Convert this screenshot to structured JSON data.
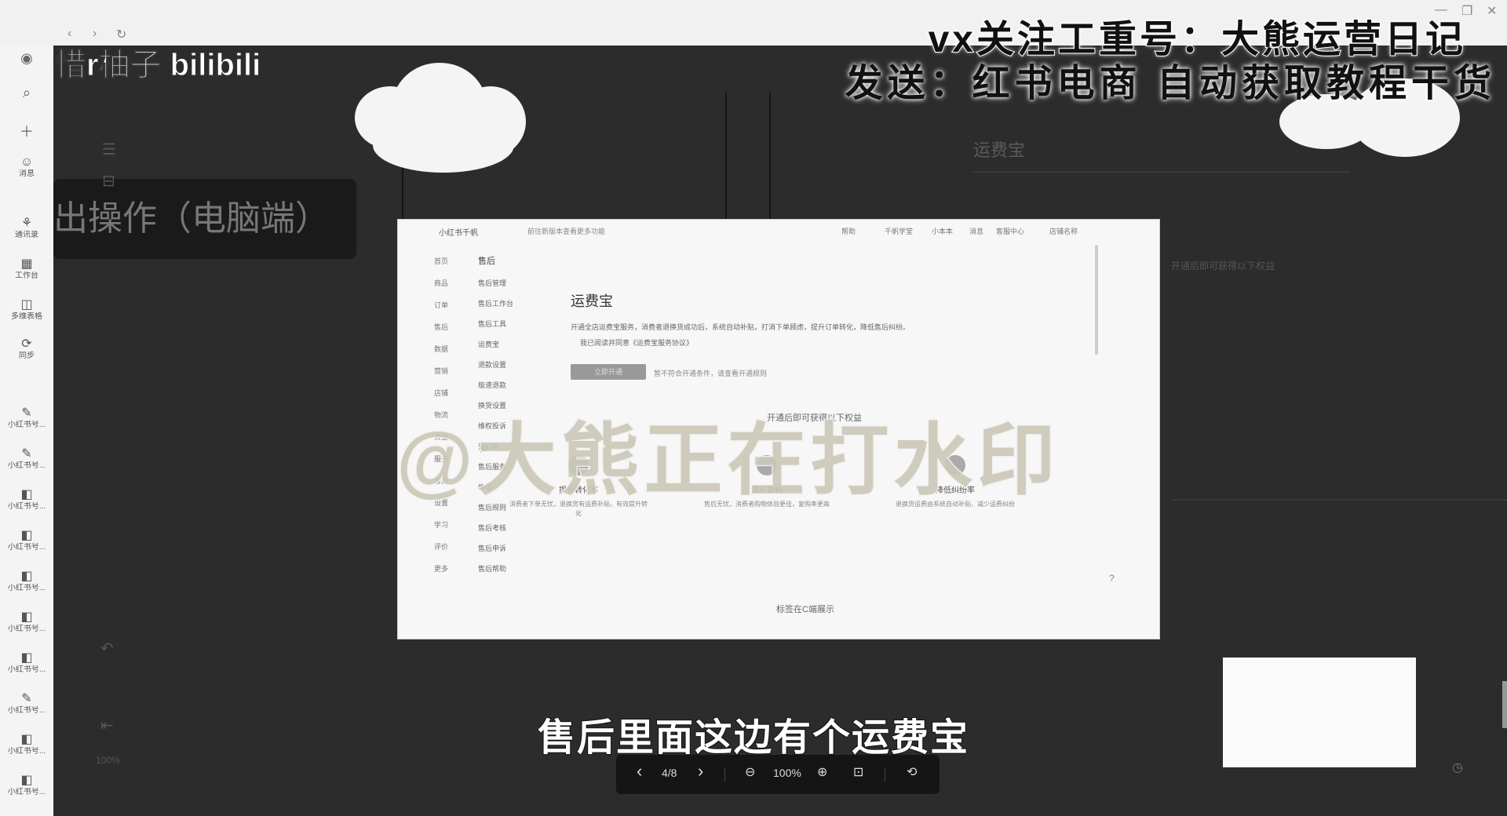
{
  "topbar": {
    "nav": [
      "‹",
      "›",
      "↻"
    ],
    "window_controls": [
      "—",
      "❐",
      "✕"
    ]
  },
  "brand": {
    "text": "惜r柚子 bilibili"
  },
  "watermarks": {
    "vx": "vx关注工重号：大熊运营日记",
    "send": "发送：红书电商  自动获取教程干货",
    "center": "@大熊正在打水印"
  },
  "rail": {
    "items": [
      {
        "icon": "☺",
        "label": "消息"
      },
      {
        "icon": "⚘",
        "label": "通讯录"
      },
      {
        "icon": "▦",
        "label": "工作台"
      },
      {
        "icon": "◫",
        "label": "多维表格"
      },
      {
        "icon": "⟳",
        "label": "同步"
      },
      {
        "icon": "✎",
        "label": "小红书号..."
      },
      {
        "icon": "✎",
        "label": "小红书号..."
      },
      {
        "icon": "◧",
        "label": "小红书号..."
      },
      {
        "icon": "◧",
        "label": "小红书号..."
      },
      {
        "icon": "◧",
        "label": "小红书号..."
      },
      {
        "icon": "◧",
        "label": "小红书号..."
      },
      {
        "icon": "◧",
        "label": "小红书号..."
      },
      {
        "icon": "✎",
        "label": "小红书号..."
      },
      {
        "icon": "◧",
        "label": "小红书号..."
      },
      {
        "icon": "◧",
        "label": "小红书号..."
      }
    ]
  },
  "canvas": {
    "node_text": "出操作（电脑端）",
    "ghost_title": "运费宝",
    "ghost_section": "开通后即可获得以下权益",
    "ghost_zoom": "100%"
  },
  "preview": {
    "logo": "小红书千帆",
    "crumb": "前往新版本查看更多功能",
    "top_links": [
      "帮助",
      "千帆学堂",
      "小本本",
      "消息",
      "客服中心"
    ],
    "store": "店铺名称",
    "sidebar": [
      "首页",
      "商品",
      "订单",
      "售后",
      "数据",
      "营销",
      "店铺",
      "物流",
      "资金",
      "服务",
      "客服",
      "设置",
      "学习",
      "评价",
      "更多"
    ],
    "menu_heading": "售后",
    "menu": [
      "售后管理",
      "售后工作台",
      "售后工具",
      "运费宝",
      "退款设置",
      "极速退款",
      "换货设置",
      "维权投诉",
      "安心购",
      "售后服务",
      "仲裁",
      "售后规则",
      "售后考核",
      "售后申诉",
      "售后帮助"
    ],
    "title": "运费宝",
    "desc": "开通全店运费宝服务，消费者退换货成功后，系统自动补贴，打消下单顾虑，提升订单转化，降低售后纠纷。",
    "sub": "我已阅读并同意《运费宝服务协议》",
    "button": "立即开通",
    "button_note": "暂不符合开通条件，请查看开通规则",
    "section": "开通后即可获得以下权益",
    "features": [
      {
        "title": "提升转化率",
        "desc": "消费者下单无忧，退换货有运费补贴，有效提升转化"
      },
      {
        "title": "提升复购",
        "desc": "售后无忧，消费者购物体验更佳，复购率更高"
      },
      {
        "title": "降低纠纷率",
        "desc": "退换货运费由系统自动补贴，减少运费纠纷"
      }
    ],
    "footer": "标签在C端展示",
    "help": "?"
  },
  "subtitle": "售后里面这边有个运费宝",
  "controls": {
    "prev": "‹",
    "page": "4/8",
    "next": "›",
    "zoom_out": "⊖",
    "zoom": "100%",
    "zoom_in": "⊕",
    "fit": "⊡",
    "rotate": "⟲"
  }
}
